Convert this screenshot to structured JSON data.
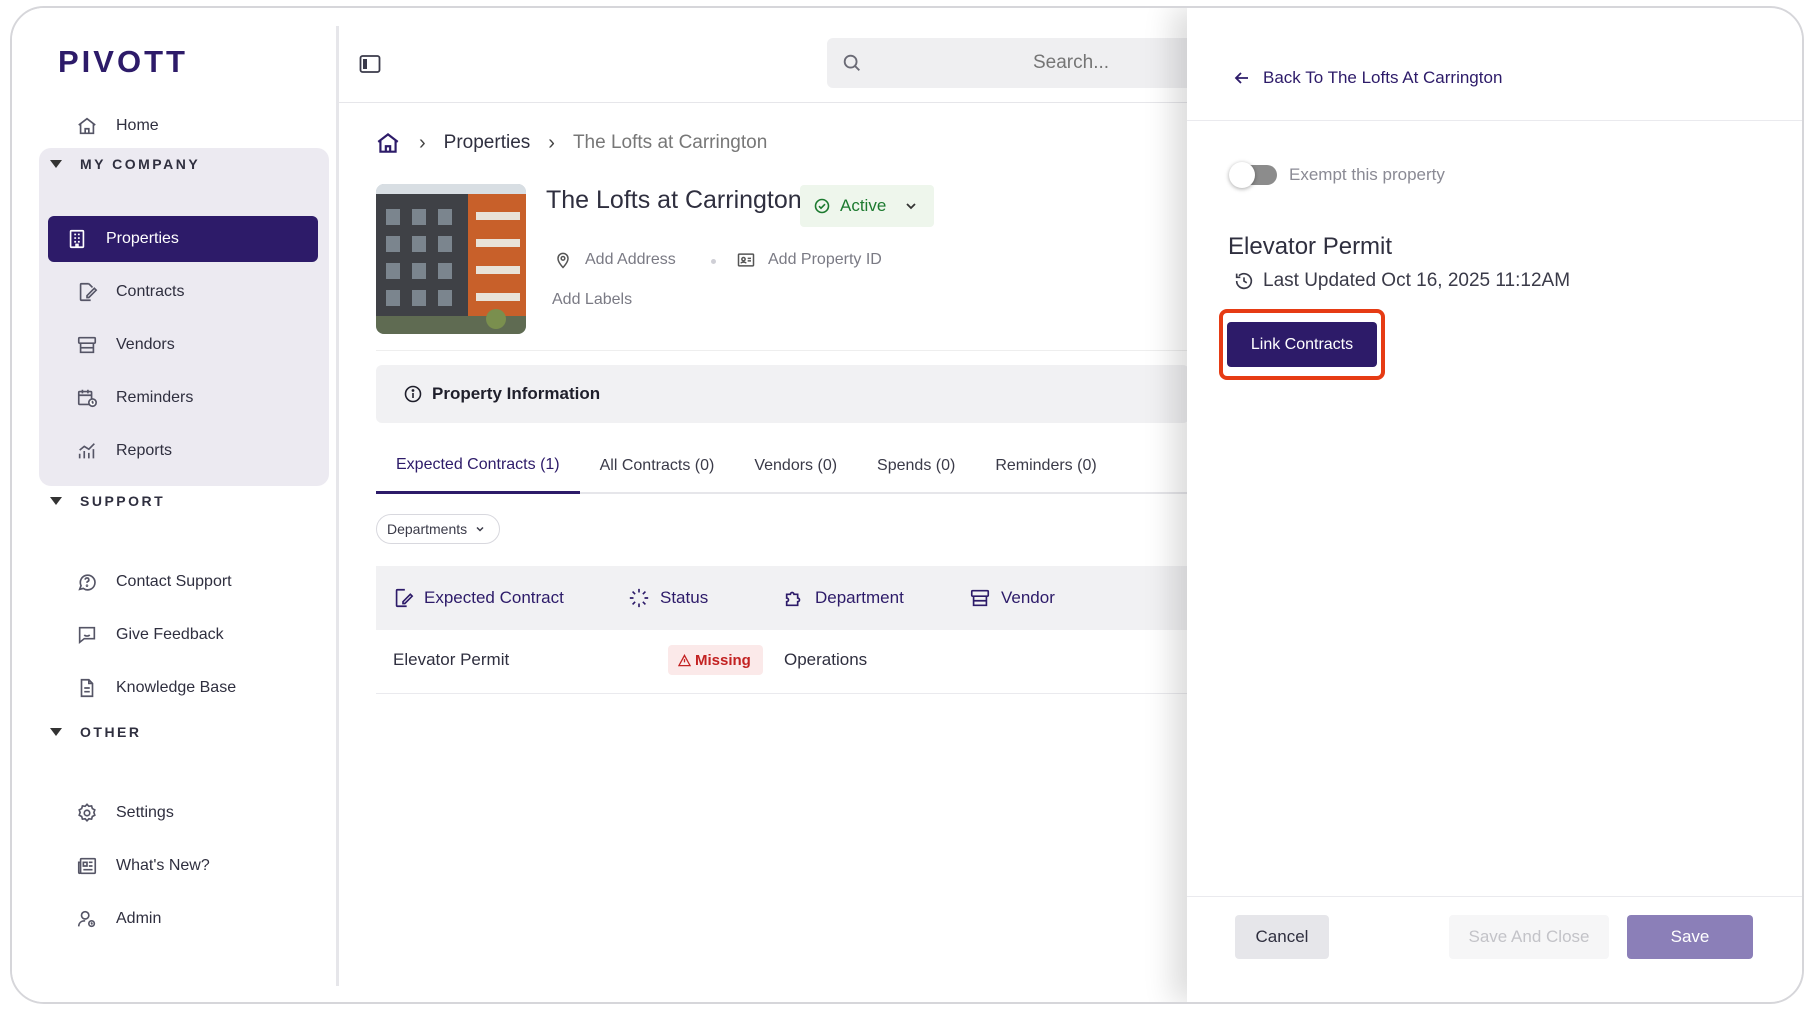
{
  "app": {
    "logo": "PIVOTT"
  },
  "sidebar": {
    "home_label": "Home",
    "sections": {
      "my_company": "MY COMPANY",
      "support": "SUPPORT",
      "other": "OTHER"
    },
    "company_items": [
      {
        "label": "Properties",
        "icon": "building-icon",
        "active": true
      },
      {
        "label": "Contracts",
        "icon": "contract-icon"
      },
      {
        "label": "Vendors",
        "icon": "store-icon"
      },
      {
        "label": "Reminders",
        "icon": "calendar-clock-icon"
      },
      {
        "label": "Reports",
        "icon": "chart-icon"
      }
    ],
    "support_items": [
      {
        "label": "Contact Support",
        "icon": "chat-question-icon"
      },
      {
        "label": "Give Feedback",
        "icon": "feedback-icon"
      },
      {
        "label": "Knowledge Base",
        "icon": "document-icon"
      }
    ],
    "other_items": [
      {
        "label": "Settings",
        "icon": "gear-icon"
      },
      {
        "label": "What's New?",
        "icon": "newspaper-icon"
      },
      {
        "label": "Admin",
        "icon": "user-admin-icon"
      }
    ]
  },
  "topbar": {
    "search_placeholder": "Search..."
  },
  "breadcrumb": {
    "items": [
      "Properties",
      "The Lofts at Carrington"
    ]
  },
  "property": {
    "title": "The Lofts at Carrington",
    "status": "Active",
    "add_address": "Add Address",
    "add_property_id": "Add Property ID",
    "add_labels": "Add Labels"
  },
  "info_section": {
    "title": "Property Information"
  },
  "tabs": [
    {
      "label": "Expected Contracts (1)",
      "active": true
    },
    {
      "label": "All Contracts (0)"
    },
    {
      "label": "Vendors (0)"
    },
    {
      "label": "Spends (0)"
    },
    {
      "label": "Reminders (0)"
    }
  ],
  "filter": {
    "departments_label": "Departments"
  },
  "table": {
    "columns": [
      "Expected Contract",
      "Status",
      "Department",
      "Vendor"
    ],
    "rows": [
      {
        "contract": "Elevator Permit",
        "status": "Missing",
        "department": "Operations",
        "vendor": ""
      }
    ]
  },
  "drawer": {
    "back_label": "Back To The Lofts At Carrington",
    "exempt_label": "Exempt this property",
    "exempt_on": false,
    "title": "Elevator Permit",
    "last_updated": "Last Updated Oct 16, 2025 11:12AM",
    "link_button": "Link Contracts",
    "cancel": "Cancel",
    "save_and_close": "Save And Close",
    "save": "Save"
  },
  "colors": {
    "brand": "#2d1b69",
    "highlight": "#e63b14",
    "status_active": "#1c7a2f",
    "status_missing": "#c32222"
  }
}
